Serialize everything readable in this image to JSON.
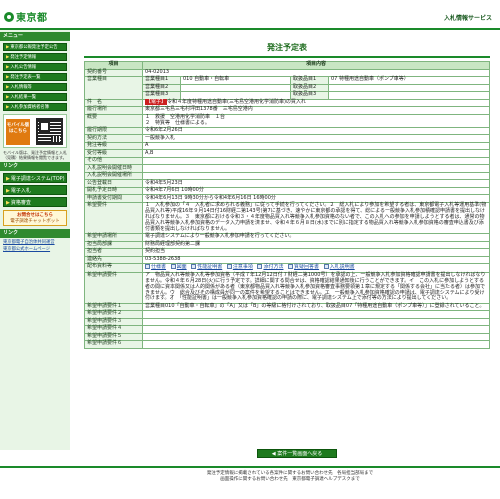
{
  "header": {
    "logo_text": "東京都",
    "site_title": "入札情報サービス"
  },
  "sidebar": {
    "menu_heading": "メニュー",
    "menu_items": [
      "東京都公報発注予定公告",
      "発注予定情報",
      "入札公告情報",
      "発注予定表一覧",
      "入札情報等",
      "入札結果一覧",
      "入札参加資格者名簿"
    ],
    "mobile_badge": "モバイル版",
    "mobile_badge_sub": "はこちら",
    "mobile_note": "モバイル版は、発注予定情報と入札（見積）結果情報を閲覧できます。",
    "links_heading": "リンク",
    "big_items": [
      "電子調達システム(TOP)",
      "電子入札",
      "資格審査"
    ],
    "banner_line1": "お問合せはこちら",
    "banner_line2": "電子調達チャットボット",
    "links_heading2": "リンク",
    "links": [
      "東京都電子自治体共同運営",
      "東京都公式ホームページ"
    ]
  },
  "main": {
    "page_title": "発注予定表",
    "table_header": {
      "item": "項目",
      "content": "項目内容"
    },
    "rows": {
      "contract_no_label": "契約番号",
      "contract_no": "04-02013",
      "business_type_label": "営業種目",
      "business": [
        {
          "k": "営業種目1",
          "v": "010 自動車・自転車",
          "k2": "取扱品目1",
          "v2": "07 特種用途自動車（ポンプ車等）"
        },
        {
          "k": "営業種目2",
          "v": "",
          "k2": "取扱品目2",
          "v2": ""
        },
        {
          "k": "営業種目3",
          "v": "",
          "k2": "取扱品目3",
          "v2": ""
        }
      ],
      "subject_label": "件　名",
      "subject_tag": "【電子】",
      "subject": "令和４年度特種用途自動車(三宅島空港用化学消防車)の買入れ",
      "location_label": "履行場所",
      "location": "東京都三宅島三宅村坪田1378番　三宅島空港内",
      "summary_label": "概要",
      "summary_1": "１　救援　空港用化学消防車　１台",
      "summary_2": "２　特質等　仕様書による。",
      "period_label": "履行期限",
      "period": "令和6年2月26日",
      "method_label": "契約方法",
      "method": "一般競争入札",
      "size_label": "発注等級",
      "size": "A",
      "grade_label": "受付等級",
      "grade": "A,B",
      "other_label": "その他",
      "other": "",
      "open_date_label": "入札説明会開催日時",
      "open_date": "",
      "open_place_label": "入札説明会開催場所",
      "open_place": "",
      "announce_label": "公告登載日",
      "announce": "令和4年5月23日",
      "bid_open_label": "開札予定日時",
      "bid_open": "令和4年7月6日 10時00分",
      "bid_period_label": "申請書受付期間",
      "bid_period": "令和4年6月13日 9時30分から令和4年6月16日 16時00分",
      "req_label": "希望要件",
      "req_text": "１　入札参加の「４　入札者に求められる義務」に従って手続を行ってください。２　総入札により参加を希望する者は、東京都電子入札等運用基準(物品買入れ等)平成16年９月14日付16財経二第143号)第7に基づき、速やかに東京都の承認を得て、総によるー般競争入札参加積確認申請書を提出しなければなりません。３　東京都における令和３・４年度物品買入れ等競争入札参加資格のない者で、この入札への参加を申請しようとする者は、通常の物品買入れ等競争入札参加資格のデータ入力申請を済ませ、令和４年６月８日(水)までに別に指定する物品買入れ等競争入札参加資格の審査申込書及び添付書類を提出しなければなりません。",
      "apply_method_label": "希望申請場所",
      "apply_method": "電子調達システムにより一般競争入札参加申請を行ってください。",
      "dept_label": "担当局部課",
      "dept": "財務局経理部契約第二課",
      "person_label": "担当者",
      "person": "契約担当",
      "tel_label": "連絡先",
      "tel": "03-5388-2638",
      "docs_label": "配布資料等",
      "docs": [
        "仕様書",
        "図面",
        "性能証明書",
        "注意事項",
        "添付方法",
        "質疑回答書",
        "入札説明書"
      ],
      "qual_label": "希望申請要件",
      "qual_text": "ア　物品買入れ等競争入札等参加資格（平成７年12月12日付７財経二第1000号）を承認の上、一般競争入札参加資格確認申請書を提出しなければなりません。令和４年６月28日(火)に行う予定です。詳細に関する問合せは、資格確認結果通知後に行うことができます。イ　この入札に参加しようとする者の間に資本関係又は人的関係がある者（東京都物品買入れ等競争入札参加資格審査事務要領第１章に規定する「関係する会社」に当たる者）は参加できません。ウ　総合及びその構成員が同一の案件を希望することはできません。エ　一般競争入札参加資格確認の申請は、電子調達システムにより受け付けます。オ　「性能証明書」は一般競争入札参加資格確認の申請の際に、電子調達システム上で添付等の方法により提出してください。",
      "remark_label": "希望申請要件１",
      "remark": "営業種目010「自動車・自転車」の「A」又は「B」の等級に格付けされており、取扱品目07「特種用途自動車（ポンプ車等）」に登録されていること。",
      "extra_labels": [
        "希望申請要件２",
        "希望申請要件３",
        "希望申請要件４",
        "希望申請要件５",
        "希望申請要件６"
      ]
    },
    "back_button": "案件一覧画面へ戻る"
  },
  "footer": {
    "line1": "発注予定情報に掲載されている各案件に関するお問い合わせ先　各局担当部局まで",
    "line2": "画面操作に関するお問い合わせ先　東京都電子調達ヘルプデスクまで"
  }
}
